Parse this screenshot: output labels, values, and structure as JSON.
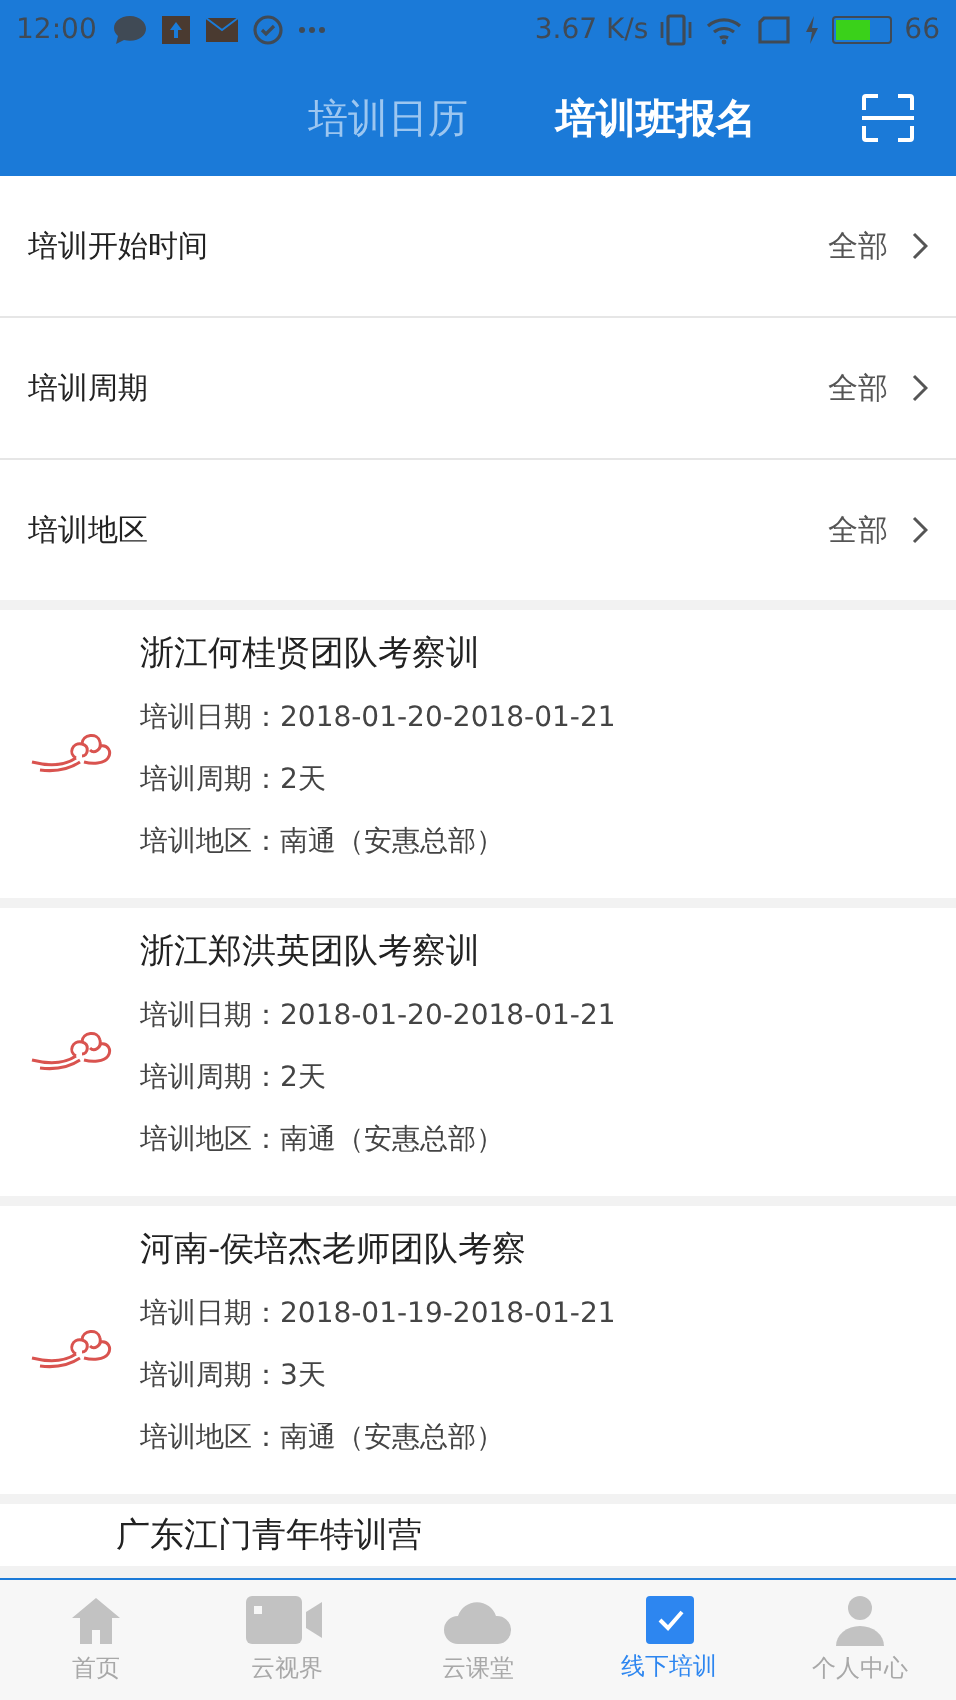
{
  "status_bar": {
    "time": "12:00",
    "speed": "3.67 K/s",
    "battery": "66"
  },
  "header": {
    "tabs": [
      {
        "label": "培训日历",
        "selected": false
      },
      {
        "label": "培训班报名",
        "selected": true
      }
    ]
  },
  "filters": [
    {
      "label": "培训开始时间",
      "value": "全部"
    },
    {
      "label": "培训周期",
      "value": "全部"
    },
    {
      "label": "培训地区",
      "value": "全部"
    }
  ],
  "courses": [
    {
      "title": "浙江何桂贤团队考察训",
      "date": "培训日期：2018-01-20-2018-01-21",
      "period": "培训周期：2天",
      "region": "培训地区：南通（安惠总部）"
    },
    {
      "title": "浙江郑洪英团队考察训",
      "date": "培训日期：2018-01-20-2018-01-21",
      "period": "培训周期：2天",
      "region": "培训地区：南通（安惠总部）"
    },
    {
      "title": "河南-侯培杰老师团队考察",
      "date": "培训日期：2018-01-19-2018-01-21",
      "period": "培训周期：3天",
      "region": "培训地区：南通（安惠总部）"
    },
    {
      "title": "广东江门青年特训营"
    }
  ],
  "bottom_nav": [
    {
      "label": "首页",
      "selected": false
    },
    {
      "label": "云视界",
      "selected": false
    },
    {
      "label": "云课堂",
      "selected": false
    },
    {
      "label": "线下培训",
      "selected": true
    },
    {
      "label": "个人中心",
      "selected": false
    }
  ]
}
